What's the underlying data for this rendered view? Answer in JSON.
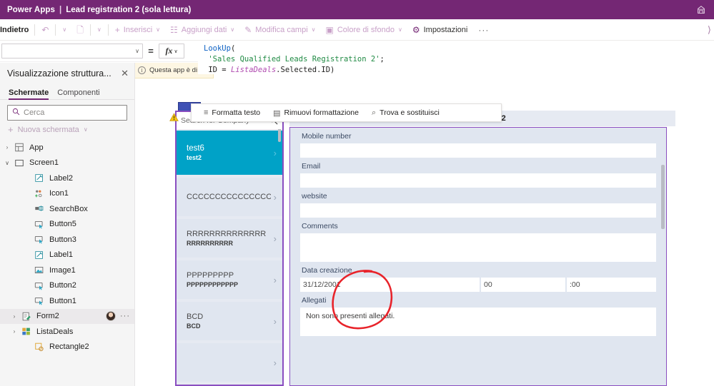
{
  "header": {
    "brand": "Power Apps",
    "separator": "|",
    "app_name": "Lead registration 2 (sola lettura)",
    "right_icon": "org-icon"
  },
  "ribbon": {
    "back_label": "Indietro",
    "items": [
      {
        "label": "Inserisci",
        "glyph": "+",
        "caret": "∨",
        "enabled": false
      },
      {
        "label": "Aggiungi dati",
        "glyph": "☷",
        "caret": "∨",
        "enabled": false
      },
      {
        "label": "Modifica campi",
        "glyph": "✎",
        "caret": "∨",
        "enabled": false
      },
      {
        "label": "Colore di sfondo",
        "glyph": "▣",
        "caret": "∨",
        "enabled": false
      },
      {
        "label": "Impostazioni",
        "glyph": "⚙",
        "caret": "",
        "enabled": true
      }
    ],
    "undo_caret": "∨",
    "copy_caret": "∨",
    "overflow": "···",
    "right_caret": "⟩"
  },
  "formula_bar": {
    "property_value": "",
    "property_caret": "∨",
    "equals": "=",
    "fx_label": "fx",
    "fx_caret": "∨",
    "formula_lines": [
      {
        "tokens": [
          {
            "t": "LookUp",
            "k": "fn"
          },
          {
            "t": "(",
            "k": "punc"
          }
        ]
      },
      {
        "tokens": [
          {
            "t": " 'Sales Qualified Leads Registration 2'",
            "k": "str"
          },
          {
            "t": ";",
            "k": "punc"
          }
        ]
      },
      {
        "tokens": [
          {
            "t": " ID ",
            "k": "plain"
          },
          {
            "t": "= ",
            "k": "punc"
          },
          {
            "t": "ListaDeals",
            "k": "var"
          },
          {
            "t": ".Selected.ID)",
            "k": "plain"
          }
        ]
      }
    ]
  },
  "tree_panel": {
    "title": "Visualizzazione struttura...",
    "close_glyph": "✕",
    "tabs": [
      {
        "label": "Schermate",
        "active": true
      },
      {
        "label": "Componenti",
        "active": false
      }
    ],
    "search_placeholder": "Cerca",
    "search_icon": "search-icon",
    "new_screen_label": "Nuova schermata",
    "new_screen_plus": "+",
    "new_screen_caret": "∨",
    "nodes": [
      {
        "label": "App",
        "level": 0,
        "twisty": "›",
        "icon": "app-icon",
        "selected": false
      },
      {
        "label": "Screen1",
        "level": 0,
        "twisty": "∨",
        "icon": "screen-icon",
        "selected": false
      },
      {
        "label": "Label2",
        "level": 2,
        "twisty": "",
        "icon": "label-icon",
        "selected": false
      },
      {
        "label": "Icon1",
        "level": 2,
        "twisty": "",
        "icon": "icon-icon",
        "selected": false
      },
      {
        "label": "SearchBox",
        "level": 2,
        "twisty": "",
        "icon": "textinput-icon",
        "selected": false
      },
      {
        "label": "Button5",
        "level": 2,
        "twisty": "",
        "icon": "button-icon",
        "selected": false
      },
      {
        "label": "Button3",
        "level": 2,
        "twisty": "",
        "icon": "button-icon",
        "selected": false
      },
      {
        "label": "Label1",
        "level": 2,
        "twisty": "",
        "icon": "label-icon",
        "selected": false
      },
      {
        "label": "Image1",
        "level": 2,
        "twisty": "",
        "icon": "image-icon",
        "selected": false
      },
      {
        "label": "Button2",
        "level": 2,
        "twisty": "",
        "icon": "button-icon",
        "selected": false
      },
      {
        "label": "Button1",
        "level": 2,
        "twisty": "",
        "icon": "button-icon",
        "selected": false
      },
      {
        "label": "Form2",
        "level": 1,
        "twisty": "›",
        "icon": "form-icon",
        "selected": true
      },
      {
        "label": "ListaDeals",
        "level": 1,
        "twisty": "›",
        "icon": "gallery-icon",
        "selected": false
      },
      {
        "label": "Rectangle2",
        "level": 2,
        "twisty": "",
        "icon": "shape-icon",
        "selected": false
      }
    ]
  },
  "canvas": {
    "warning_banner": "Questa app è di",
    "warning_icon": "info-icon",
    "warning_triangle": "warning-triangle-icon",
    "float_toolbar": [
      {
        "label": "Formatta testo",
        "glyph": "≡"
      },
      {
        "label": "Rimuovi formattazione",
        "glyph": "▤"
      },
      {
        "label": "Trova e sostituisci",
        "glyph": "⌕"
      }
    ],
    "gallery": {
      "search_placeholder": "Search for Company",
      "search_icon": "search-icon",
      "items": [
        {
          "title": "test6",
          "subtitle": "test2",
          "selected": true
        },
        {
          "title": "CCCCCCCCCCCCCCCCCCC",
          "subtitle": "",
          "selected": false
        },
        {
          "title": "RRRRRRRRRRRRRR",
          "subtitle": "RRRRRRRRRR",
          "selected": false
        },
        {
          "title": "PPPPPPPPP",
          "subtitle": "PPPPPPPPPPPP",
          "selected": false
        },
        {
          "title": "BCD",
          "subtitle": "BCD",
          "selected": false
        },
        {
          "title": "",
          "subtitle": "",
          "selected": false
        }
      ],
      "chevron": "›"
    },
    "detail": {
      "title": "LEAD : test2",
      "fields": [
        {
          "label": "Mobile number",
          "value": "",
          "type": "text"
        },
        {
          "label": "Email",
          "value": "",
          "type": "text"
        },
        {
          "label": "website",
          "value": "",
          "type": "text"
        },
        {
          "label": "Comments",
          "value": "",
          "type": "textarea"
        }
      ],
      "date_field": {
        "label": "Data creazione",
        "date_value": "31/12/2001",
        "hour_value": "00",
        "minute_value": ":00"
      },
      "attachments": {
        "label": "Allegati",
        "empty_text": "Non sono presenti allegati."
      }
    },
    "annotation": {
      "shape": "red-circle-annotation",
      "color": "#e8232a"
    }
  }
}
